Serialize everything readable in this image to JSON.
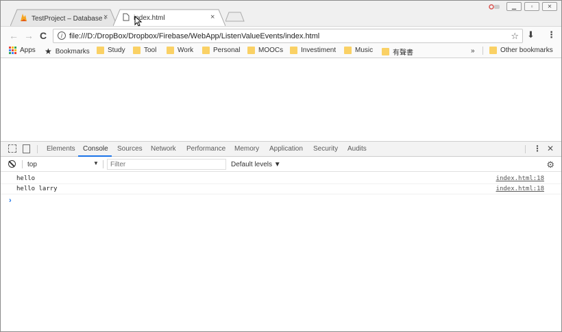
{
  "tabs": [
    {
      "title": "TestProject – Database -",
      "close": "×"
    },
    {
      "title": "index.html",
      "close": "×"
    }
  ],
  "address_bar": {
    "url": "file:///D:/DropBox/Dropbox/Firebase/WebApp/ListenValueEvents/index.html",
    "info_icon": "i"
  },
  "bookmarks": {
    "apps": "Apps",
    "items": [
      "Bookmarks",
      "Study",
      "Tool",
      "Work",
      "Personal",
      "MOOCs",
      "Investiment",
      "Music",
      "有聲書"
    ],
    "overflow": "»",
    "other": "Other bookmarks"
  },
  "devtools": {
    "tabs": [
      "Elements",
      "Console",
      "Sources",
      "Network",
      "Performance",
      "Memory",
      "Application",
      "Security",
      "Audits"
    ],
    "active_tab": "Console",
    "context": "top",
    "filter_placeholder": "Filter",
    "levels": "Default levels ▼",
    "logs": [
      {
        "message": "hello",
        "source": "index.html:18"
      },
      {
        "message": "hello larry",
        "source": "index.html:18"
      }
    ],
    "prompt": "›"
  },
  "colors": {
    "accent": "#1a73e8",
    "folder": "#fad165"
  }
}
